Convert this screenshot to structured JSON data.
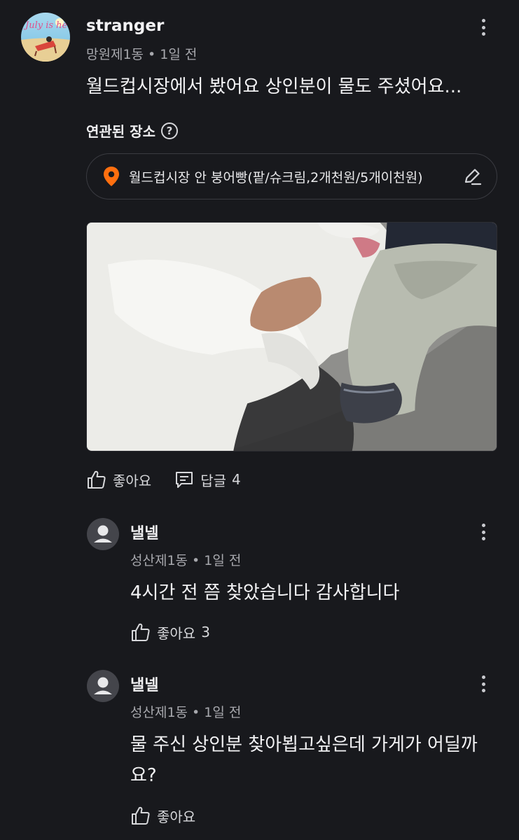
{
  "post": {
    "author": "stranger",
    "location": "망원제1동",
    "separator": "•",
    "time": "1일 전",
    "text": "월드컵시장에서 봤어요 상인분이 물도 주셨어요...",
    "avatar_text": "July is here",
    "related_title": "연관된 장소",
    "help_icon_glyph": "?",
    "place_name": "월드컵시장 안 붕어빵(팥/슈크림,2개천원/5개이천원)",
    "like_label": "좋아요",
    "reply_label": "답글",
    "reply_count": "4"
  },
  "comments": [
    {
      "author": "낼넬",
      "location": "성산제1동",
      "separator": "•",
      "time": "1일 전",
      "text": "4시간 전 쯤 찾았습니다 감사합니다",
      "like_label": "좋아요",
      "like_count": "3"
    },
    {
      "author": "낼넬",
      "location": "성산제1동",
      "separator": "•",
      "time": "1일 전",
      "text": "물 주신 상인분 찾아뵙고싶은데 가게가 어딜까요?",
      "like_label": "좋아요",
      "like_count": ""
    }
  ],
  "colors": {
    "background": "#18191d",
    "pin": "#ff6f0f",
    "muted_text": "#a7a8ad"
  },
  "icons": [
    "kebab-icon",
    "help-icon",
    "location-pin-icon",
    "edit-icon",
    "thumbs-up-icon",
    "reply-icon",
    "default-avatar-icon"
  ]
}
